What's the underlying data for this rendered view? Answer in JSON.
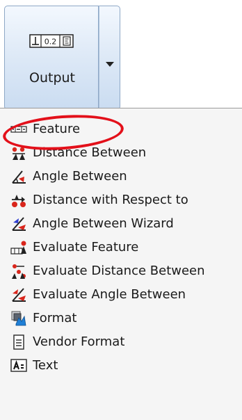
{
  "ribbon": {
    "output_button": {
      "label": "Output",
      "icon": "feature-control-frame-icon",
      "icon_text": "0.2",
      "split_icon": "chevron-down-icon"
    }
  },
  "menu": {
    "items": [
      {
        "label": "Feature",
        "icon": "feature-control-frame-icon"
      },
      {
        "label": "Distance Between",
        "icon": "distance-between-icon"
      },
      {
        "label": "Angle Between",
        "icon": "angle-between-icon"
      },
      {
        "label": "Distance with Respect to",
        "icon": "distance-respect-icon"
      },
      {
        "label": "Angle Between Wizard",
        "icon": "angle-wizard-icon"
      },
      {
        "label": "Evaluate Feature",
        "icon": "evaluate-feature-icon"
      },
      {
        "label": "Evaluate Distance Between",
        "icon": "evaluate-distance-icon"
      },
      {
        "label": "Evaluate Angle Between",
        "icon": "evaluate-angle-icon"
      },
      {
        "label": "Format",
        "icon": "format-icon"
      },
      {
        "label": "Vendor Format",
        "icon": "vendor-format-icon"
      },
      {
        "label": "Text",
        "icon": "text-icon"
      }
    ]
  },
  "colors": {
    "highlight": "#e3101a",
    "button_border": "#8ea8c6",
    "menu_background": "#f5f5f5"
  }
}
